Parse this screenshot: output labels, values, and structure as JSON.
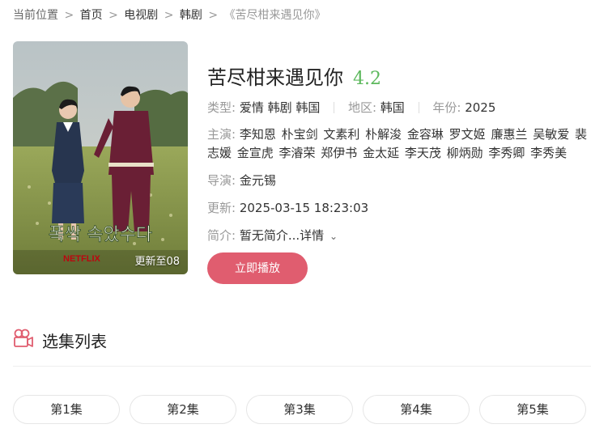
{
  "breadcrumb": {
    "prefix": "当前位置",
    "items": [
      "首页",
      "电视剧",
      "韩剧"
    ],
    "current": "《苦尽柑来遇见你》"
  },
  "poster": {
    "badge": "更新至08",
    "title_korean": "폭싹 속았수다",
    "brand": "NETFLIX"
  },
  "detail": {
    "title": "苦尽柑来遇见你",
    "score": "4.2",
    "type_label": "类型:",
    "type_value": "爱情 韩剧 韩国",
    "region_label": "地区:",
    "region_value": "韩国",
    "year_label": "年份:",
    "year_value": "2025",
    "cast_label": "主演:",
    "cast_value": "李知恩 朴宝剑 文素利 朴解浚 金容琳 罗文姬 廉惠兰 吴敏爱 裴志媛 金宣虎 李濬荣 郑伊书 金太延 李天茂 柳炳勋 李秀卿 李秀美",
    "director_label": "导演:",
    "director_value": "金元锡",
    "update_label": "更新:",
    "update_value": "2025-03-15 18:23:03",
    "intro_label": "简介:",
    "intro_value": "暂无简介...详情"
  },
  "actions": {
    "play_label": "立即播放"
  },
  "episodes_section": {
    "title": "选集列表",
    "episodes": [
      "第1集",
      "第2集",
      "第3集",
      "第4集",
      "第5集"
    ]
  },
  "colors": {
    "accent": "#e05d6f",
    "score": "#5cb85c",
    "icon": "#e05d6f"
  }
}
